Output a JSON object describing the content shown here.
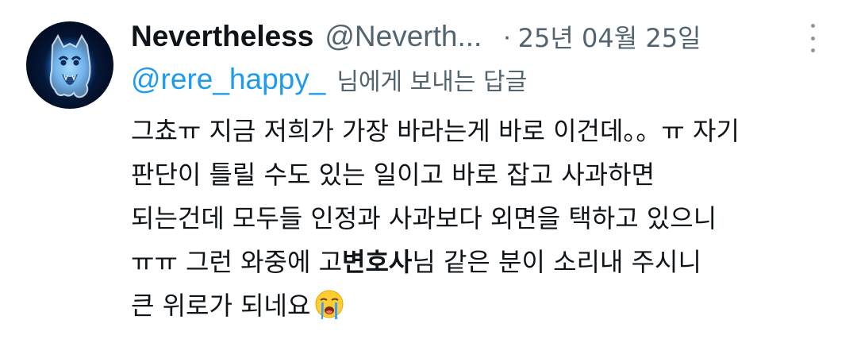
{
  "author": {
    "display_name": "Nevertheless",
    "handle": "@Neverth...",
    "separator": "·",
    "timestamp": "25년 04월 25일"
  },
  "reply": {
    "to_handle": "@rere_happy_",
    "suffix": "님에게 보내는 답글"
  },
  "body": {
    "line1": "그쵸ㅠ 지금 저희가 가장 바라는게 바로 이건데。。ㅠ 자기",
    "line2": "판단이 틀릴 수도 있는 일이고 바로 잡고 사과하면",
    "line3": "되는건데 모두들 인정과 사과보다 외면을 택하고 있으니",
    "line4_a": "ㅠㅠ 그런 와중에 고",
    "line4_bold": "변호사",
    "line4_b": "님 같은 분이 소리내 주시니",
    "line5": "큰 위로가 되네요"
  },
  "icons": {
    "avatar": "ghost-avatar",
    "more": "more-vertical-icon",
    "emoji": "loudly-crying-face-emoji"
  },
  "colors": {
    "link": "#1d9bf0",
    "secondary": "#536471",
    "text": "#0f1419"
  }
}
